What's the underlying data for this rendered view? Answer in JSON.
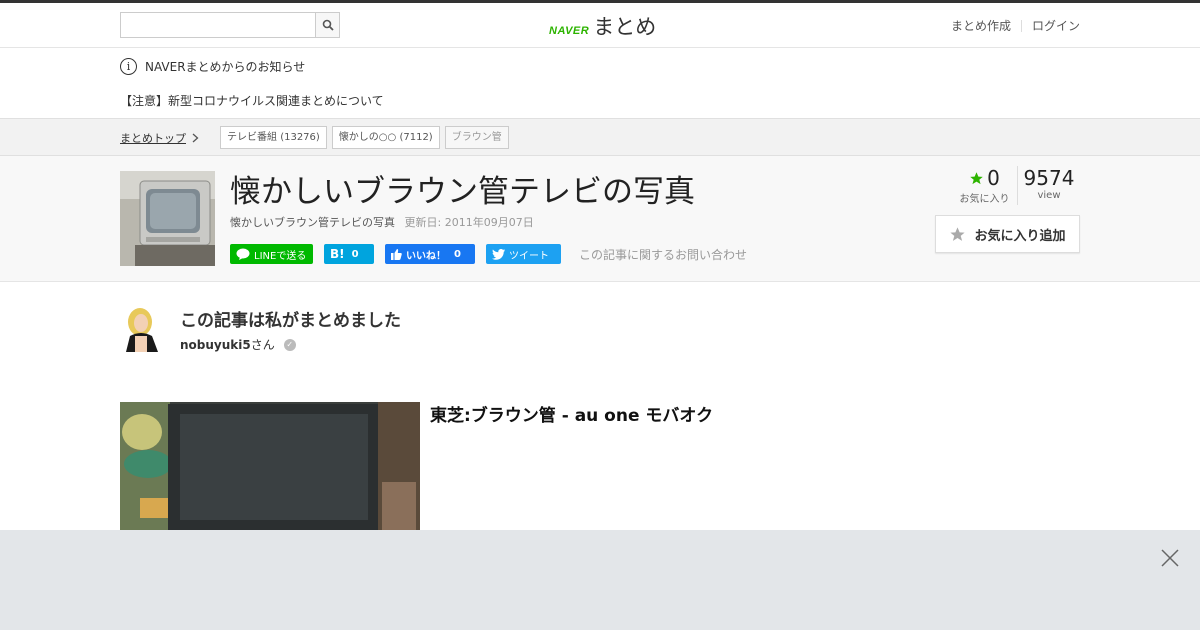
{
  "header": {
    "search_placeholder": "",
    "logo_naver": "NAVER",
    "logo_matome": "まとめ",
    "create_link": "まとめ作成",
    "login_link": "ログイン"
  },
  "notice": {
    "icon": "info-icon",
    "heading": "NAVERまとめからのお知らせ",
    "link": "【注意】新型コロナウイルス関連まとめについて"
  },
  "breadcrumb": {
    "top": "まとめトップ",
    "tags": [
      {
        "label": "テレビ番組",
        "count": "(13276)"
      },
      {
        "label": "懐かしの○○",
        "count": "(7112)"
      },
      {
        "label": "ブラウン管",
        "count": ""
      }
    ]
  },
  "article": {
    "title": "懐かしいブラウン管テレビの写真",
    "description": "懐かしいブラウン管テレビの写真",
    "updated": "更新日: 2011年09月07日",
    "share": {
      "line": "LINEで送る",
      "hatena_icon": "B!",
      "hatena_count": "0",
      "fb_label": "いいね！",
      "fb_count": "0",
      "tweet": "ツイート",
      "contact": "この記事に関するお問い合わせ"
    },
    "stats": {
      "fav_count": "0",
      "fav_label": "お気に入り",
      "view_count": "9574",
      "view_label": "view"
    },
    "fav_button": "お気に入り追加"
  },
  "author": {
    "heading": "この記事は私がまとめました",
    "username": "nobuyuki5",
    "suffix": "さん"
  },
  "item": {
    "title": "東芝:ブラウン管 - au one モバオク"
  },
  "colors": {
    "brand_green": "#2db400",
    "line": "#00b900",
    "hatena": "#00a4de",
    "facebook": "#1877f2",
    "twitter": "#1da1f2"
  }
}
